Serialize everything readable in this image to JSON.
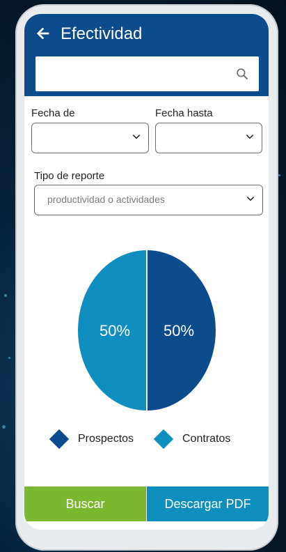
{
  "header": {
    "title": "Efectividad"
  },
  "search": {
    "placeholder": ""
  },
  "filters": {
    "fecha_de_label": "Fecha de",
    "fecha_hasta_label": "Fecha hasta",
    "tipo_label": "Tipo de reporte",
    "tipo_value": "productividad o actividades"
  },
  "chart_data": {
    "type": "pie",
    "categories": [
      "Prospectos",
      "Contratos"
    ],
    "values": [
      50,
      50
    ],
    "labels": [
      "50%",
      "50%"
    ],
    "colors": [
      "#0c4c8c",
      "#0f8fbf"
    ],
    "legend": "bottom"
  },
  "legend": [
    {
      "label": "Prospectos",
      "color": "#0c4c8c"
    },
    {
      "label": "Contratos",
      "color": "#0f8fbf"
    }
  ],
  "buttons": {
    "search": "Buscar",
    "download": "Descargar PDF"
  },
  "colors": {
    "header": "#0c4c8c",
    "search_button": "#7cb82f",
    "download_button": "#0f8fbf"
  }
}
